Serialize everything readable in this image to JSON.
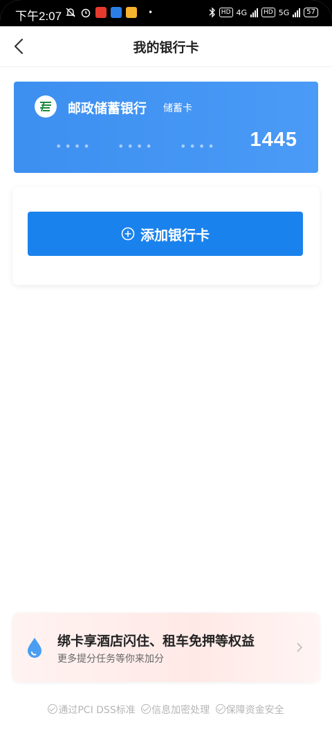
{
  "status_bar": {
    "time": "下午2:07",
    "network_1": "4G",
    "network_2": "5G",
    "hd_label": "HD",
    "battery": "57"
  },
  "header": {
    "title": "我的银行卡"
  },
  "card": {
    "bank_name": "邮政储蓄银行",
    "card_type": "储蓄卡",
    "masked_group": "••••",
    "last_digits": "1445",
    "accent_color": "#3d8ff0"
  },
  "add_card": {
    "label": "添加银行卡",
    "button_color": "#1a82ec"
  },
  "promo": {
    "title": "绑卡享酒店闪住、租车免押等权益",
    "subtitle": "更多提分任务等你来加分"
  },
  "security": {
    "items": [
      "通过PCI DSS标准",
      "信息加密处理",
      "保障资金安全"
    ]
  }
}
